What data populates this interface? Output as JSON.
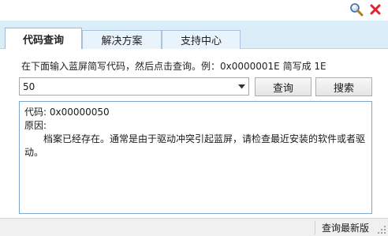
{
  "window": {
    "icons": [
      "search-icon",
      "close-icon"
    ]
  },
  "tabs": [
    {
      "label": "代码查询",
      "active": true
    },
    {
      "label": "解决方案",
      "active": false
    },
    {
      "label": "支持中心",
      "active": false
    }
  ],
  "main": {
    "hint": "在下面输入蓝屏简写代码，然后点击查询。例：0x0000001E 简写成 1E",
    "code_input": {
      "value": "50"
    },
    "query_button": "查询",
    "search_button": "搜索",
    "result": {
      "code_line": "代码: 0x00000050",
      "reason_label": "原因:",
      "reason_text": "档案已经存在。通常是由于驱动冲突引起蓝屏，请检查最近安装的软件或者驱动。"
    }
  },
  "statusbar": {
    "update_link": "查询最新版"
  },
  "colors": {
    "tab_strip": "#dcedfa",
    "result_border": "#7ea6cc",
    "close_red": "#e0232e"
  }
}
